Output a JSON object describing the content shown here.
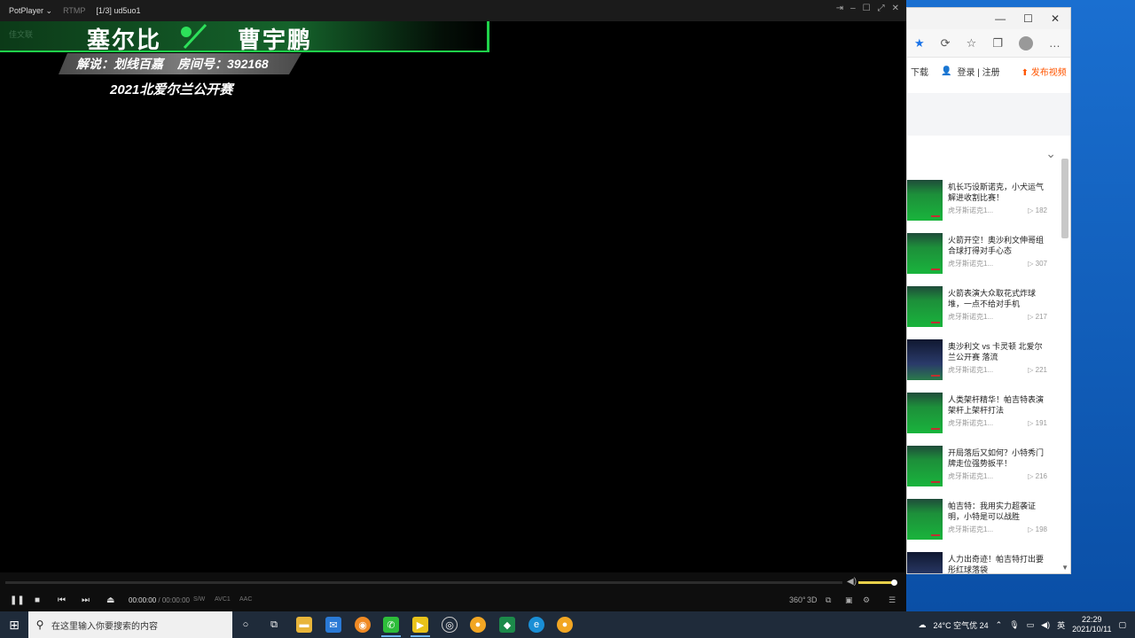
{
  "player": {
    "brand": "PotPlayer ⌄",
    "protocol": "RTMP",
    "file": "[1/3] ud5uo1",
    "controls": {
      "time_current": "00:00:00",
      "time_sep": "/",
      "time_total": "00:00:00",
      "s_w": "S/W",
      "video_codec": "AVC1",
      "audio_codec": "AAC",
      "view_360": "360°",
      "view_3d": "3D"
    }
  },
  "overlay": {
    "player_left": "塞尔比",
    "player_right": "曹宇鹏",
    "commentary": "解说：划线百嘉",
    "room": "房间号：392168",
    "tournament": "2021北爱尔兰公开赛",
    "ghost": "佳文联"
  },
  "browser": {
    "nav": {
      "download": "下载",
      "login": "登录 | 注册",
      "upload": "发布视频"
    },
    "videos": [
      {
        "title": "机长巧设斯诺克，小犬运气解进收割比赛！",
        "channel": "虎牙斯诺克1...",
        "views": "▷ 182"
      },
      {
        "title": "火箭开空！奥沙利文伸哥组合球打得对手心态",
        "channel": "虎牙斯诺克1...",
        "views": "▷ 307"
      },
      {
        "title": "火箭表演大众取花式炸球堆，一点不给对手机",
        "channel": "虎牙斯诺克1...",
        "views": "▷ 217"
      },
      {
        "title": "奥沙利文 vs 卡灵顿 北爱尔兰公开赛 落流",
        "channel": "虎牙斯诺克1...",
        "views": "▷ 221"
      },
      {
        "title": "人类架杆精华！帕吉特表演架杆上架杆打法",
        "channel": "虎牙斯诺克1...",
        "views": "▷ 191"
      },
      {
        "title": "开局落后又如何？小特秀门牌走位强势扳平！",
        "channel": "虎牙斯诺克1...",
        "views": "▷ 216"
      },
      {
        "title": "帕吉特：我用实力超袭证明，小特是可以战胜",
        "channel": "虎牙斯诺克1...",
        "views": "▷ 198"
      },
      {
        "title": "人力出奇迹！帕吉特打出要彤红球落袋",
        "channel": "",
        "views": ""
      }
    ]
  },
  "taskbar": {
    "search_placeholder": "在这里输入你要搜索的内容",
    "weather": "24°C 空气优 24",
    "ime": "英",
    "time": "22:29",
    "date": "2021/10/11"
  }
}
